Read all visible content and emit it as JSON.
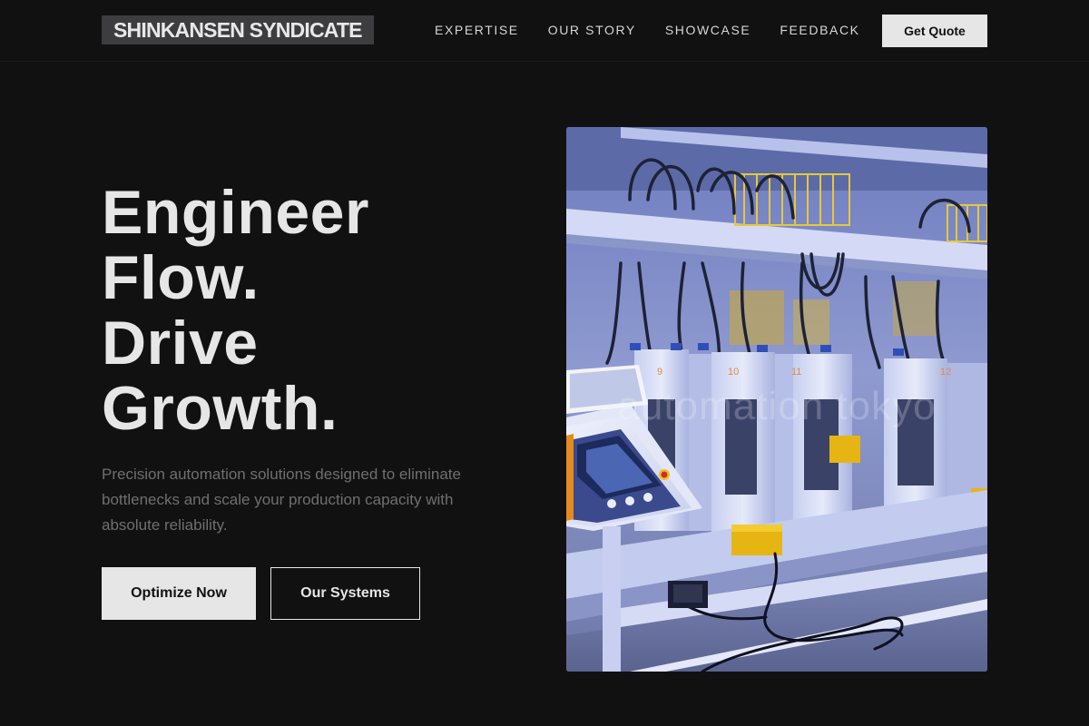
{
  "header": {
    "logo": "SHINKANSEN SYNDICATE",
    "nav": [
      {
        "label": "EXPERTISE"
      },
      {
        "label": "OUR STORY"
      },
      {
        "label": "SHOWCASE"
      },
      {
        "label": "FEEDBACK"
      }
    ],
    "cta_label": "Get Quote"
  },
  "hero": {
    "title_lines": [
      "Engineer",
      "Flow.",
      "Drive",
      "Growth."
    ],
    "description": "Precision automation solutions designed to eliminate bottlenecks and scale your production capacity with absolute reliability.",
    "primary_button": "Optimize Now",
    "secondary_button": "Our Systems",
    "image_watermark": "automation tokyo",
    "machine_station_numbers": [
      "9",
      "10",
      "11",
      "12"
    ]
  },
  "colors": {
    "background": "#111112",
    "text_primary": "#e6e6e6",
    "text_muted": "#6f6f71",
    "logo_bg": "#3d3d3f",
    "machine_blue": "#9aa6d8",
    "safety_yellow": "#e6b514"
  }
}
